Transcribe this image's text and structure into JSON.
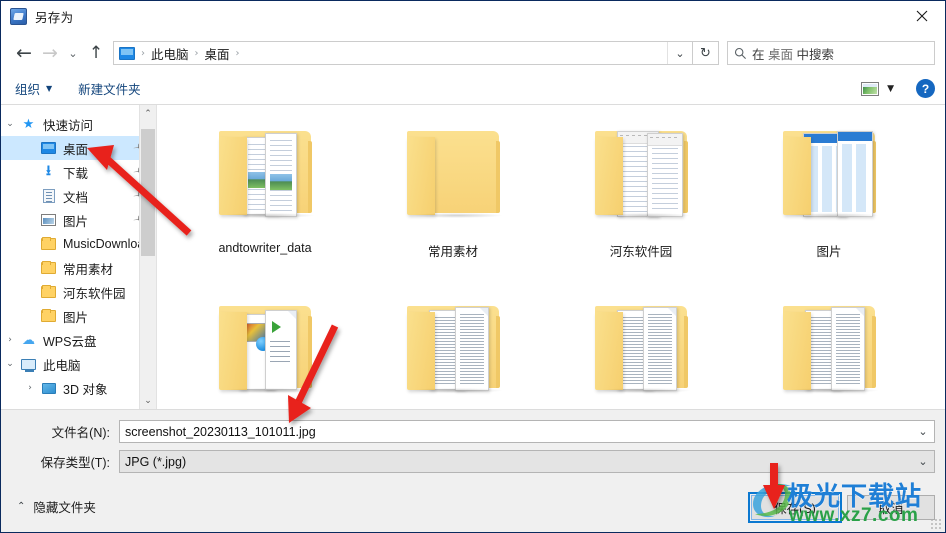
{
  "window": {
    "title": "另存为",
    "icon": "save-as-icon",
    "close_label": "✕"
  },
  "nav": {
    "back_icon": "arrow-left-icon",
    "forward_icon": "arrow-right-icon",
    "recent_icon": "chevron-down-icon",
    "up_icon": "arrow-up-icon",
    "breadcrumb": [
      "此电脑",
      "桌面"
    ],
    "breadcrumb_root_icon": "this-pc-icon",
    "dropdown_icon": "chevron-down-icon",
    "refresh_icon": "refresh-icon",
    "search_placeholder_pre": "在 ",
    "search_placeholder_target": "桌面",
    "search_placeholder_post": " 中搜索",
    "search_icon": "search-icon"
  },
  "commandbar": {
    "organize": "组织",
    "new_folder": "新建文件夹",
    "view_icon": "view-layout-icon",
    "view_caret": "▾",
    "help": "?"
  },
  "sidebar": {
    "items": [
      {
        "label": "快速访问",
        "icon": "star-icon",
        "chevron": "⌄",
        "indent": 0,
        "selected": false,
        "pinned": false
      },
      {
        "label": "桌面",
        "icon": "monitor-icon",
        "chevron": "",
        "indent": 1,
        "selected": true,
        "pinned": true
      },
      {
        "label": "下载",
        "icon": "download-icon",
        "chevron": "",
        "indent": 1,
        "selected": false,
        "pinned": true
      },
      {
        "label": "文档",
        "icon": "document-icon",
        "chevron": "",
        "indent": 1,
        "selected": false,
        "pinned": true
      },
      {
        "label": "图片",
        "icon": "picture-icon",
        "chevron": "",
        "indent": 1,
        "selected": false,
        "pinned": true
      },
      {
        "label": "MusicDownloa",
        "icon": "folder-icon",
        "chevron": "",
        "indent": 1,
        "selected": false,
        "pinned": false
      },
      {
        "label": "常用素材",
        "icon": "folder-icon",
        "chevron": "",
        "indent": 1,
        "selected": false,
        "pinned": false
      },
      {
        "label": "河东软件园",
        "icon": "folder-icon",
        "chevron": "",
        "indent": 1,
        "selected": false,
        "pinned": false
      },
      {
        "label": "图片",
        "icon": "folder-icon",
        "chevron": "",
        "indent": 1,
        "selected": false,
        "pinned": false
      },
      {
        "label": "WPS云盘",
        "icon": "cloud-icon",
        "chevron": "›",
        "indent": 0,
        "selected": false,
        "pinned": false
      },
      {
        "label": "此电脑",
        "icon": "this-pc-icon",
        "chevron": "⌄",
        "indent": 0,
        "selected": false,
        "pinned": false
      },
      {
        "label": "3D 对象",
        "icon": "3d-objects-icon",
        "chevron": "›",
        "indent": 1,
        "selected": false,
        "pinned": false
      }
    ],
    "scroll_up_icon": "chevron-up-icon",
    "scroll_down_icon": "chevron-down-icon"
  },
  "filelist": {
    "items": [
      {
        "label": "andtowriter_data",
        "icon": "folder-with-documents-icon",
        "variant": "docpic"
      },
      {
        "label": "常用素材",
        "icon": "folder-icon",
        "variant": "plain"
      },
      {
        "label": "河东软件园",
        "icon": "folder-with-documents-icon",
        "variant": "office"
      },
      {
        "label": "图片",
        "icon": "folder-with-documents-icon",
        "variant": "blueui"
      },
      {
        "label": "",
        "icon": "folder-with-documents-icon",
        "variant": "media"
      },
      {
        "label": "",
        "icon": "folder-with-documents-icon",
        "variant": "text"
      },
      {
        "label": "",
        "icon": "folder-with-documents-icon",
        "variant": "text2"
      },
      {
        "label": "",
        "icon": "folder-with-documents-icon",
        "variant": "text3"
      }
    ]
  },
  "form": {
    "filename_label": "文件名(N):",
    "filename_value": "screenshot_20230113_101011.jpg",
    "filetype_label": "保存类型(T):",
    "filetype_value": "JPG (*.jpg)",
    "dropdown_icon": "chevron-down-icon",
    "hide_folders_label": "隐藏文件夹",
    "hide_folders_chevron": "⌃",
    "save_button": "保存(S)",
    "cancel_button": "取消"
  },
  "watermark": {
    "title": "极光下载站",
    "url": "www.xz7.com"
  },
  "colors": {
    "accent": "#0b78d0",
    "selection": "#cce8ff",
    "folder": "#f7d277",
    "annotation": "#e8201a",
    "watermark_blue": "#1f7fd6",
    "watermark_green": "#2aa148"
  },
  "annotations": [
    {
      "name": "arrow-to-desktop-sidebar",
      "points_at": "桌面"
    },
    {
      "name": "arrow-to-file-area",
      "points_at": "file-list"
    },
    {
      "name": "arrow-to-save-button",
      "points_at": "保存(S)"
    }
  ]
}
